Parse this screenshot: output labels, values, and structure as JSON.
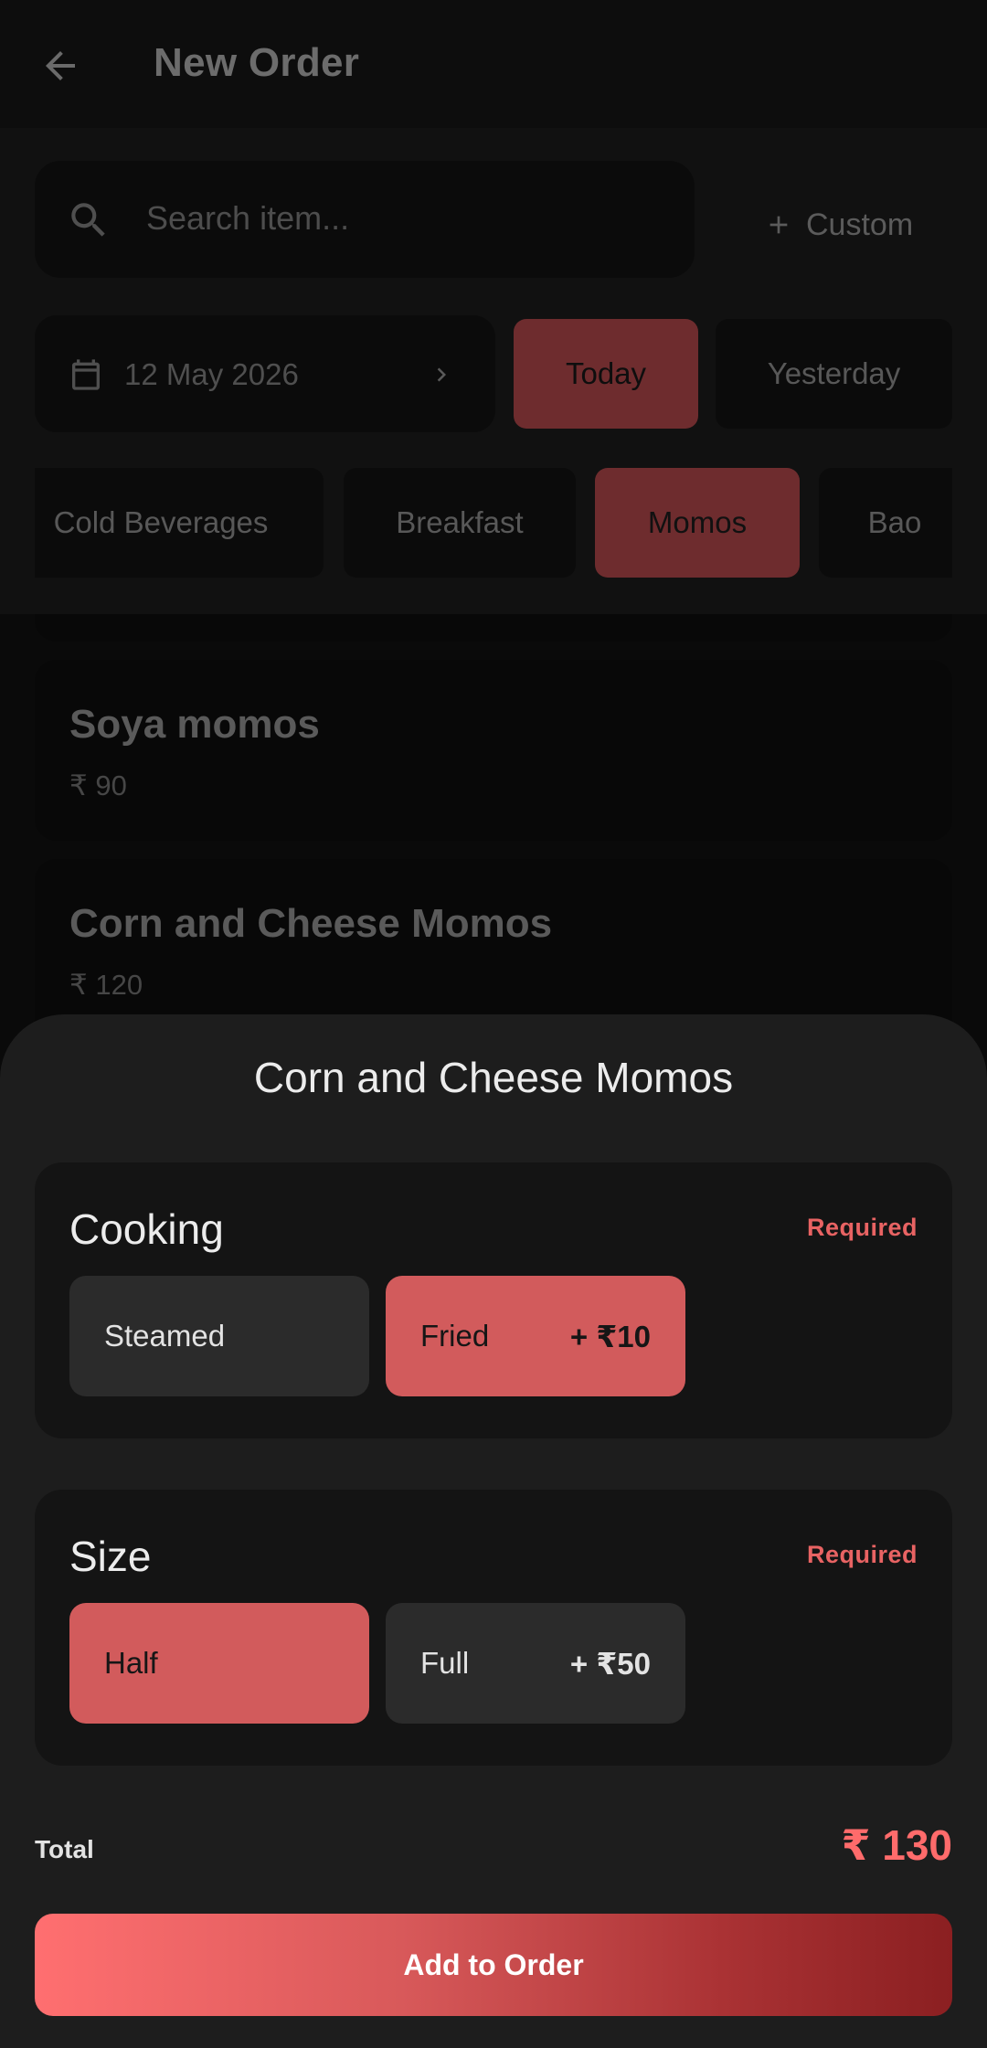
{
  "appbar": {
    "title": "New Order",
    "back_icon": "arrow-left-icon"
  },
  "search": {
    "placeholder": "Search item...",
    "custom_label": "Custom"
  },
  "date": {
    "value": "12 May 2026",
    "chips": {
      "today": "Today",
      "yesterday": "Yesterday"
    },
    "selected": "Today"
  },
  "categories": {
    "items": [
      "Cold Beverages",
      "Breakfast",
      "Momos",
      "Bao"
    ],
    "selected": "Momos"
  },
  "items": [
    {
      "name": "Soya momos",
      "price": "₹ 90"
    },
    {
      "name": "Corn and Cheese Momos",
      "price": "₹ 120"
    }
  ],
  "sheet": {
    "title": "Corn and Cheese Momos",
    "groups": [
      {
        "title": "Cooking",
        "required": "Required",
        "options": [
          {
            "label": "Steamed",
            "extra": "",
            "selected": false
          },
          {
            "label": "Fried",
            "extra": "+ ₹10",
            "selected": true
          }
        ]
      },
      {
        "title": "Size",
        "required": "Required",
        "options": [
          {
            "label": "Half",
            "extra": "",
            "selected": true
          },
          {
            "label": "Full",
            "extra": "+ ₹50",
            "selected": false
          }
        ]
      }
    ],
    "total_label": "Total",
    "total_value": "₹ 130",
    "add_label": "Add to Order"
  },
  "colors": {
    "accent": "#d25b5c",
    "price_accent": "#ff6b6b",
    "sheet_bg": "#1d1d1d"
  }
}
